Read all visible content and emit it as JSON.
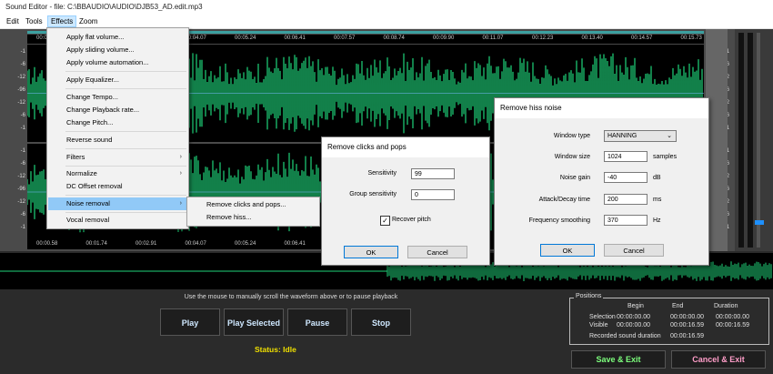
{
  "window": {
    "title": "Sound Editor - file: C:\\BBAUDIO\\AUDIO\\DJB53_AD.edit.mp3"
  },
  "menubar": {
    "items": [
      "Edit",
      "Tools",
      "Effects",
      "Zoom"
    ]
  },
  "ruler_top": [
    "00:01.17",
    "00:02.35",
    "00:03.52",
    "00:04.07",
    "00:05.24",
    "00:06.41",
    "00:07.57",
    "00:08.74",
    "00:09.90",
    "00:11.07",
    "00:12.23",
    "00:13.40",
    "00:14.57",
    "00:15.73"
  ],
  "ruler_bottom": [
    "00:00.58",
    "00:01.74",
    "00:02.91",
    "00:04.07",
    "00:05.24",
    "00:06.41"
  ],
  "db_scale": [
    "-1",
    "-6",
    "-12",
    "-96",
    "-12",
    "-6",
    "-1"
  ],
  "effects_menu": {
    "items": [
      "Apply flat volume...",
      "Apply sliding volume...",
      "Apply volume automation...",
      "Apply Equalizer...",
      "Change Tempo...",
      "Change Playback rate...",
      "Change Pitch...",
      "Reverse sound",
      "Filters",
      "Normalize",
      "DC Offset removal",
      "Noise removal",
      "Vocal removal"
    ]
  },
  "noise_submenu": {
    "items": [
      "Remove clicks and pops...",
      "Remove hiss..."
    ]
  },
  "clicks_dialog": {
    "title": "Remove clicks and pops",
    "sensitivity_label": "Sensitivity",
    "sensitivity_value": "99",
    "group_label": "Group sensitivity",
    "group_value": "0",
    "recover_label": "Recover pitch",
    "recover_checked": true,
    "ok": "OK",
    "cancel": "Cancel"
  },
  "hiss_dialog": {
    "title": "Remove hiss noise",
    "window_type_label": "Window type",
    "window_type_value": "HANNING",
    "window_size_label": "Window size",
    "window_size_value": "1024",
    "window_size_unit": "samples",
    "noise_gain_label": "Noise gain",
    "noise_gain_value": "-40",
    "noise_gain_unit": "dB",
    "attack_label": "Attack/Decay time",
    "attack_value": "200",
    "attack_unit": "ms",
    "freq_label": "Frequency smoothing",
    "freq_value": "370",
    "freq_unit": "Hz",
    "ok": "OK",
    "cancel": "Cancel"
  },
  "hint": "Use the mouse to manually scroll the waveform above or to pause playback",
  "playback": {
    "play": "Play",
    "play_selected": "Play Selected",
    "pause": "Pause",
    "stop": "Stop"
  },
  "status": "Status: Idle",
  "positions": {
    "title": "Positions",
    "col_begin": "Begin",
    "col_end": "End",
    "col_duration": "Duration",
    "selection_label": "Selection",
    "selection_begin": "00:00:00.00",
    "selection_end": "00:00:00.00",
    "selection_duration": "00:00:00.00",
    "visible_label": "Visible",
    "visible_begin": "00:00:00.00",
    "visible_end": "00:00:16.59",
    "visible_duration": "00:00:16.59",
    "recorded_label": "Recorded sound duration",
    "recorded_value": "00:00:16.59"
  },
  "actions": {
    "save": "Save & Exit",
    "cancel": "Cancel & Exit"
  },
  "colors": {
    "wave": "#1fd47a",
    "accent": "#0078d7",
    "status": "#f0e000",
    "save": "#7dff7d",
    "cancel_exit": "#ff9dc8"
  }
}
